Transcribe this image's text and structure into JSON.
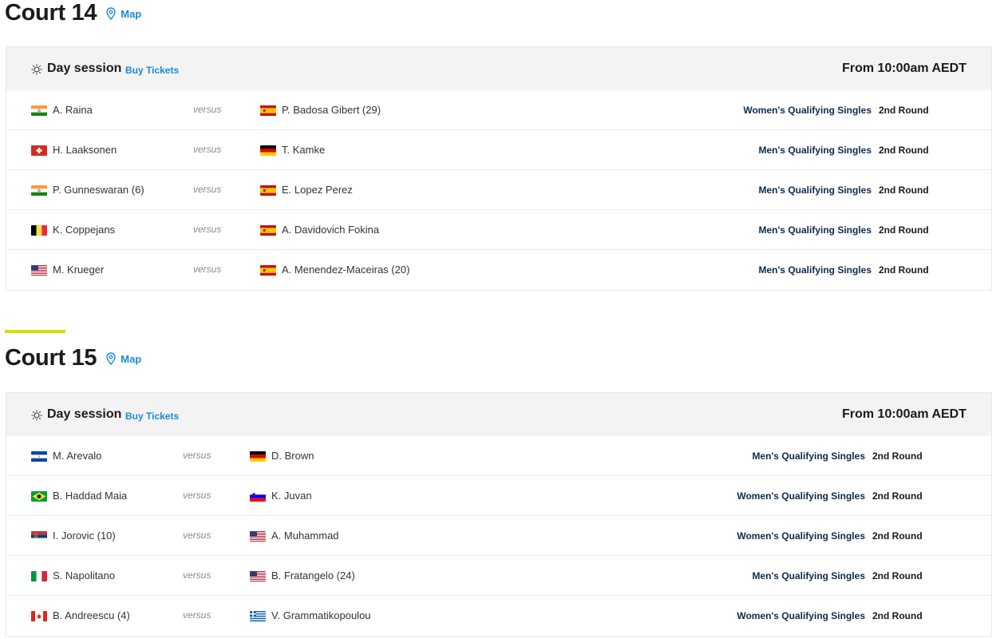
{
  "courts": [
    {
      "title": "Court 14",
      "map_label": "Map",
      "session": {
        "label": "Day session",
        "tickets_label": "Buy Tickets",
        "time": "From 10:00am AEDT"
      },
      "matches": [
        {
          "p1": "A. Raina",
          "p1_flag": "india",
          "versus": "versus",
          "p2": "P. Badosa Gibert (29)",
          "p2_flag": "spain",
          "event": "Women's Qualifying Singles",
          "round": "2nd Round"
        },
        {
          "p1": "H. Laaksonen",
          "p1_flag": "switzerland",
          "versus": "versus",
          "p2": "T. Kamke",
          "p2_flag": "germany",
          "event": "Men's Qualifying Singles",
          "round": "2nd Round"
        },
        {
          "p1": "P. Gunneswaran (6)",
          "p1_flag": "india",
          "versus": "versus",
          "p2": "E. Lopez Perez",
          "p2_flag": "spain",
          "event": "Men's Qualifying Singles",
          "round": "2nd Round"
        },
        {
          "p1": "K. Coppejans",
          "p1_flag": "belgium",
          "versus": "versus",
          "p2": "A. Davidovich Fokina",
          "p2_flag": "spain",
          "event": "Men's Qualifying Singles",
          "round": "2nd Round"
        },
        {
          "p1": "M. Krueger",
          "p1_flag": "usa",
          "versus": "versus",
          "p2": "A. Menendez-Maceiras (20)",
          "p2_flag": "spain",
          "event": "Men's Qualifying Singles",
          "round": "2nd Round"
        }
      ]
    },
    {
      "title": "Court 15",
      "map_label": "Map",
      "session": {
        "label": "Day session",
        "tickets_label": "Buy Tickets",
        "time": "From 10:00am AEDT"
      },
      "matches": [
        {
          "p1": "M. Arevalo",
          "p1_flag": "el-salvador",
          "versus": "versus",
          "p2": "D. Brown",
          "p2_flag": "germany",
          "event": "Men's Qualifying Singles",
          "round": "2nd Round"
        },
        {
          "p1": "B. Haddad Maia",
          "p1_flag": "brazil",
          "versus": "versus",
          "p2": "K. Juvan",
          "p2_flag": "slovenia",
          "event": "Women's Qualifying Singles",
          "round": "2nd Round"
        },
        {
          "p1": "I. Jorovic (10)",
          "p1_flag": "serbia",
          "versus": "versus",
          "p2": "A. Muhammad",
          "p2_flag": "usa",
          "event": "Women's Qualifying Singles",
          "round": "2nd Round"
        },
        {
          "p1": "S. Napolitano",
          "p1_flag": "italy",
          "versus": "versus",
          "p2": "B. Fratangelo (24)",
          "p2_flag": "usa",
          "event": "Men's Qualifying Singles",
          "round": "2nd Round"
        },
        {
          "p1": "B. Andreescu (4)",
          "p1_flag": "canada",
          "versus": "versus",
          "p2": "V. Grammatikopoulou",
          "p2_flag": "greece",
          "event": "Women's Qualifying Singles",
          "round": "2nd Round"
        }
      ]
    }
  ],
  "colors": {
    "accent": "#d5de00",
    "link": "#1b8ad6",
    "event": "#0d2a4e"
  }
}
